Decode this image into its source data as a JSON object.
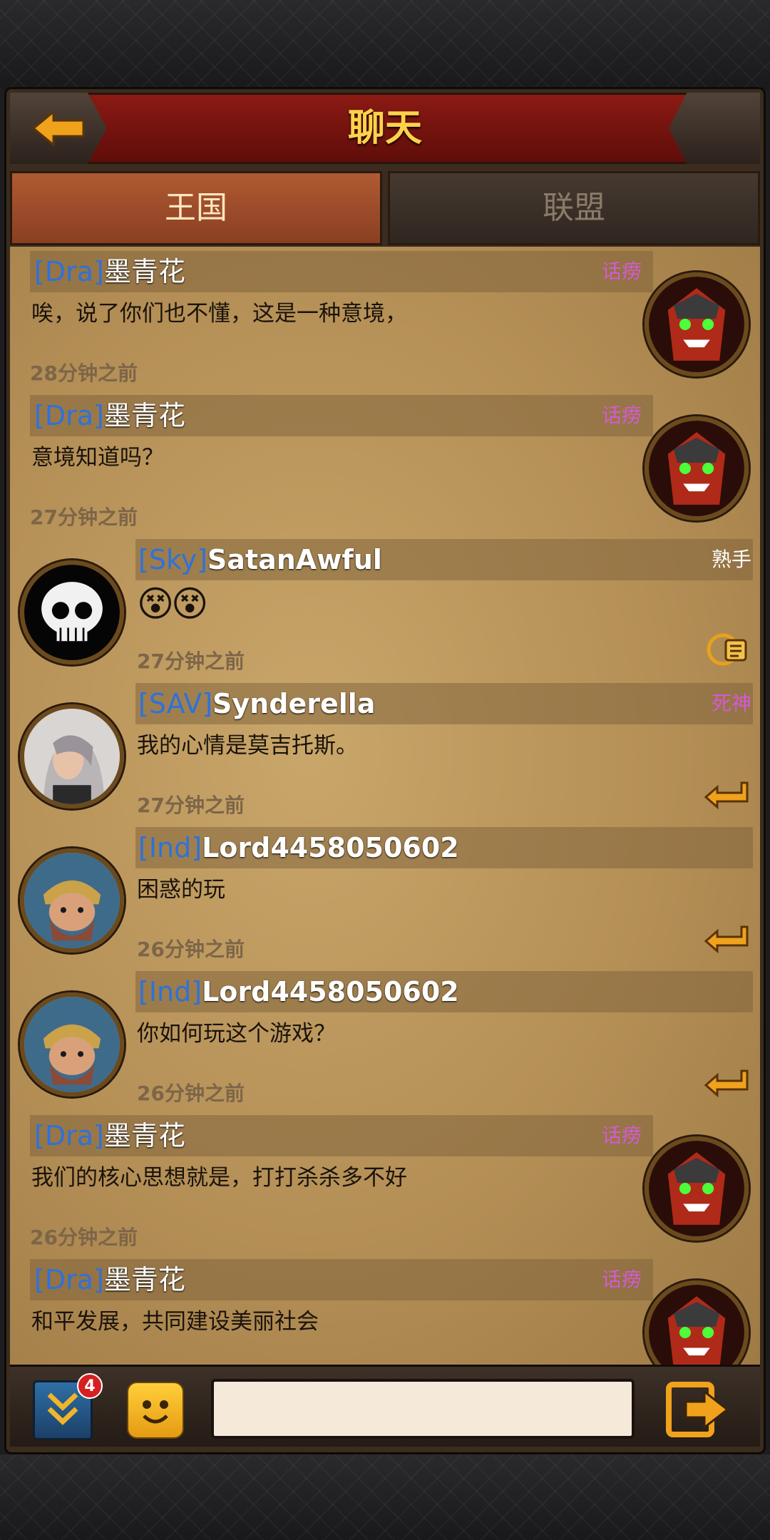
{
  "header": {
    "title": "聊天"
  },
  "tabs": [
    {
      "label": "王国",
      "active": true
    },
    {
      "label": "联盟",
      "active": false
    }
  ],
  "messages": [
    {
      "tag": "[Dra]",
      "user": "墨青花",
      "rank": "话痨",
      "text": "唉，说了你们也不懂，这是一种意境，",
      "time": "28分钟之前",
      "side": "right",
      "avatar": "red-warrior-avatar"
    },
    {
      "tag": "[Dra]",
      "user": "墨青花",
      "rank": "话痨",
      "text": "意境知道吗？",
      "time": "27分钟之前",
      "side": "right",
      "avatar": "red-warrior-avatar"
    },
    {
      "tag": "[Sky]",
      "user": "SatanAwful",
      "rank": "熟手",
      "text": "😵😵",
      "time": "27分钟之前",
      "side": "left",
      "avatar": "skull-avatar"
    },
    {
      "tag": "[SAV]",
      "user": "Synderella",
      "rank": "死神",
      "text": "我的心情是莫吉托斯。",
      "time": "27分钟之前",
      "side": "left",
      "avatar": "woman-photo-avatar"
    },
    {
      "tag": "[Ind]",
      "user": "Lord4458050602",
      "rank": "",
      "text": "困惑的玩",
      "time": "26分钟之前",
      "side": "left",
      "avatar": "dwarf-avatar"
    },
    {
      "tag": "[Ind]",
      "user": "Lord4458050602",
      "rank": "",
      "text": "你如何玩这个游戏？",
      "time": "26分钟之前",
      "side": "left",
      "avatar": "dwarf-avatar"
    },
    {
      "tag": "[Dra]",
      "user": "墨青花",
      "rank": "话痨",
      "text": "我们的核心思想就是，打打杀杀多不好",
      "time": "26分钟之前",
      "side": "right",
      "avatar": "red-warrior-avatar"
    },
    {
      "tag": "[Dra]",
      "user": "墨青花",
      "rank": "话痨",
      "text": "和平发展，共同建设美丽社会",
      "time": "",
      "side": "right",
      "avatar": "red-warrior-avatar"
    }
  ],
  "bottom": {
    "unread_count": "4",
    "input_value": "",
    "input_placeholder": ""
  },
  "colors": {
    "title": "#ffd24a",
    "tag": "#2e72d8",
    "rank": "#d55ad4",
    "active_tab": "#a14e2b"
  }
}
